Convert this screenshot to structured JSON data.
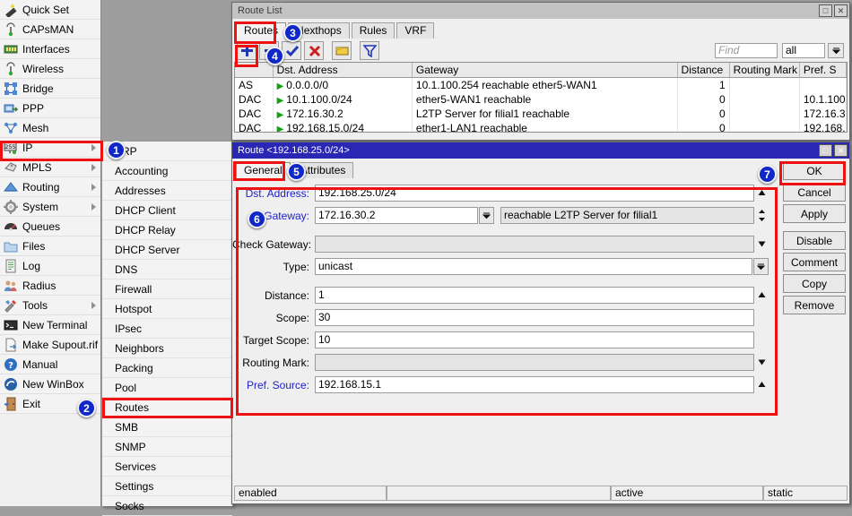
{
  "app": {
    "desktop_bg": "#9e9e9e",
    "accent_highlight": "#ee1111",
    "title_active_bg": "#2a27b5"
  },
  "sidebar": {
    "items": [
      {
        "label": "Quick Set",
        "icon": "wand-icon",
        "submenu": false
      },
      {
        "label": "CAPsMAN",
        "icon": "antenna-icon",
        "submenu": false
      },
      {
        "label": "Interfaces",
        "icon": "interfaces-icon",
        "submenu": false
      },
      {
        "label": "Wireless",
        "icon": "antenna-icon",
        "submenu": false
      },
      {
        "label": "Bridge",
        "icon": "bridge-icon",
        "submenu": false
      },
      {
        "label": "PPP",
        "icon": "ppp-icon",
        "submenu": false
      },
      {
        "label": "Mesh",
        "icon": "mesh-icon",
        "submenu": false
      },
      {
        "label": "IP",
        "icon": "ip-255-icon",
        "submenu": true
      },
      {
        "label": "MPLS",
        "icon": "tag-icon",
        "submenu": true
      },
      {
        "label": "Routing",
        "icon": "routing-icon",
        "submenu": true
      },
      {
        "label": "System",
        "icon": "gear-icon",
        "submenu": true
      },
      {
        "label": "Queues",
        "icon": "gauge-icon",
        "submenu": false
      },
      {
        "label": "Files",
        "icon": "folder-icon",
        "submenu": false
      },
      {
        "label": "Log",
        "icon": "log-icon",
        "submenu": false
      },
      {
        "label": "Radius",
        "icon": "users-icon",
        "submenu": false
      },
      {
        "label": "Tools",
        "icon": "tools-icon",
        "submenu": true
      },
      {
        "label": "New Terminal",
        "icon": "terminal-icon",
        "submenu": false
      },
      {
        "label": "Make Supout.rif",
        "icon": "document-icon",
        "submenu": false
      },
      {
        "label": "Manual",
        "icon": "help-icon",
        "submenu": false
      },
      {
        "label": "New WinBox",
        "icon": "winbox-icon",
        "submenu": false
      },
      {
        "label": "Exit",
        "icon": "exit-door-icon",
        "submenu": false
      }
    ]
  },
  "ip_submenu": {
    "items": [
      {
        "label": "ARP"
      },
      {
        "label": "Accounting"
      },
      {
        "label": "Addresses"
      },
      {
        "label": "DHCP Client"
      },
      {
        "label": "DHCP Relay"
      },
      {
        "label": "DHCP Server"
      },
      {
        "label": "DNS"
      },
      {
        "label": "Firewall"
      },
      {
        "label": "Hotspot"
      },
      {
        "label": "IPsec"
      },
      {
        "label": "Neighbors"
      },
      {
        "label": "Packing"
      },
      {
        "label": "Pool"
      },
      {
        "label": "Routes"
      },
      {
        "label": "SMB"
      },
      {
        "label": "SNMP"
      },
      {
        "label": "Services"
      },
      {
        "label": "Settings"
      },
      {
        "label": "Socks"
      }
    ]
  },
  "route_list": {
    "title": "Route List",
    "window_buttons": {
      "maximize": "□",
      "close": "✕"
    },
    "tabs": [
      {
        "label": "Routes",
        "selected": true
      },
      {
        "label": "Nexthops",
        "selected": false
      },
      {
        "label": "Rules",
        "selected": false
      },
      {
        "label": "VRF",
        "selected": false
      }
    ],
    "toolbar": [
      {
        "name": "add-button",
        "glyph": "+"
      },
      {
        "name": "remove-button",
        "glyph": "−"
      },
      {
        "name": "enable-button",
        "glyph": "✔"
      },
      {
        "name": "disable-button",
        "glyph": "✖"
      },
      {
        "name": "comment-button",
        "glyph": "▭"
      },
      {
        "name": "filter-button",
        "glyph": "▽"
      }
    ],
    "find": {
      "placeholder": "Find",
      "scope_value": "all"
    },
    "columns": [
      "",
      "Dst. Address",
      "Gateway",
      "Distance",
      "Routing Mark",
      "Pref. S"
    ],
    "rows": [
      {
        "flags": "AS",
        "dst": "0.0.0.0/0",
        "gateway": "10.1.100.254 reachable ether5-WAN1",
        "distance": "1",
        "routing_mark": "",
        "pref_source": ""
      },
      {
        "flags": "DAC",
        "dst": "10.1.100.0/24",
        "gateway": "ether5-WAN1 reachable",
        "distance": "0",
        "routing_mark": "",
        "pref_source": "10.1.100"
      },
      {
        "flags": "DAC",
        "dst": "172.16.30.2",
        "gateway": "L2TP Server for filial1 reachable",
        "distance": "0",
        "routing_mark": "",
        "pref_source": "172.16.3"
      },
      {
        "flags": "DAC",
        "dst": "192.168.15.0/24",
        "gateway": "ether1-LAN1 reachable",
        "distance": "0",
        "routing_mark": "",
        "pref_source": "192.168."
      }
    ]
  },
  "route_dialog": {
    "title": "Route <192.168.25.0/24>",
    "window_buttons": {
      "maximize": "□",
      "close": "✕"
    },
    "tabs": [
      {
        "label": "General",
        "selected": true
      },
      {
        "label": "Attributes",
        "selected": false
      }
    ],
    "fields": [
      {
        "label": "Dst. Address:",
        "value": "192.168.25.0/24",
        "label_color": "blue",
        "control": "spin",
        "dim": false
      },
      {
        "label": "Gateway:",
        "value": "172.16.30.2",
        "label_color": "blue",
        "control": "combo",
        "dim": false,
        "second_value": "reachable L2TP Server for filial1"
      },
      {
        "label": "Check Gateway:",
        "value": "",
        "label_color": "black",
        "control": "drop",
        "dim": true
      },
      {
        "label": "Type:",
        "value": "unicast",
        "label_color": "black",
        "control": "combo",
        "dim": false
      },
      {
        "label": "Distance:",
        "value": "1",
        "label_color": "black",
        "control": "spin",
        "dim": false
      },
      {
        "label": "Scope:",
        "value": "30",
        "label_color": "black",
        "control": "none",
        "dim": false
      },
      {
        "label": "Target Scope:",
        "value": "10",
        "label_color": "black",
        "control": "none",
        "dim": false
      },
      {
        "label": "Routing Mark:",
        "value": "",
        "label_color": "black",
        "control": "drop",
        "dim": true
      },
      {
        "label": "Pref. Source:",
        "value": "192.168.15.1",
        "label_color": "blue",
        "control": "spin",
        "dim": false
      }
    ],
    "buttons": [
      {
        "label": "OK",
        "group": 1
      },
      {
        "label": "Cancel",
        "group": 1
      },
      {
        "label": "Apply",
        "group": 1
      },
      {
        "label": "Disable",
        "group": 2
      },
      {
        "label": "Comment",
        "group": 2
      },
      {
        "label": "Copy",
        "group": 2
      },
      {
        "label": "Remove",
        "group": 2
      }
    ],
    "status": [
      "enabled",
      "",
      "active",
      "static"
    ]
  },
  "badges": [
    {
      "n": "1"
    },
    {
      "n": "2"
    },
    {
      "n": "3"
    },
    {
      "n": "4"
    },
    {
      "n": "5"
    },
    {
      "n": "6"
    },
    {
      "n": "7"
    }
  ]
}
